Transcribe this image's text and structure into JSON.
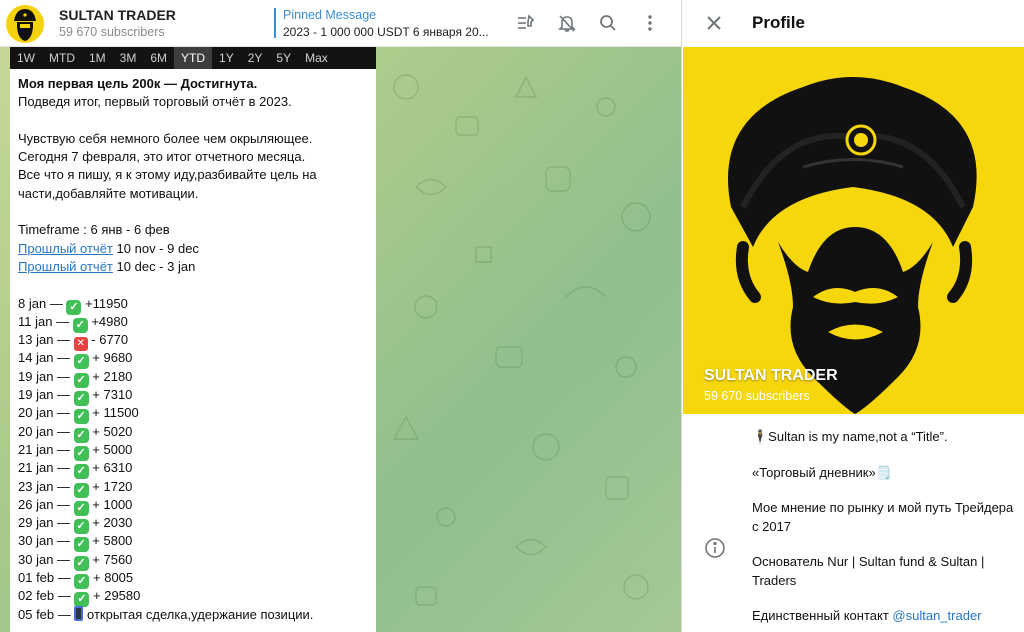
{
  "header": {
    "channel_name": "SULTAN TRADER",
    "subscribers": "59 670 subscribers",
    "pinned_label": "Pinned Message",
    "pinned_text": "2023 - 1 000 000 USDT 6 января 20..."
  },
  "timeframes": [
    "1W",
    "MTD",
    "1M",
    "3M",
    "6M",
    "YTD",
    "1Y",
    "2Y",
    "5Y",
    "Max"
  ],
  "timeframe_selected": "YTD",
  "message": {
    "title": "Моя первая цель 200к — Достигнута.",
    "line2": "Подведя итог, первый торговый отчёт в 2023.",
    "para1": "Чувствую себя немного более чем окрыляющее.",
    "para2": "Сегодня 7 февраля, это итог отчетного месяца.",
    "para3": "Все что я пишу, я к этому иду,разбивайте цель на",
    "para4": "части,добавляйте мотивации.",
    "timeframe": "Timeframe : 6 янв - 6 фев",
    "link1": "Прошлый отчёт",
    "link1_range": "10 nov - 9 dec",
    "link2": "Прошлый отчёт",
    "link2_range": "10 dec - 3 jan"
  },
  "trades": [
    {
      "date": "8 jan",
      "status": "win",
      "value": "+11950"
    },
    {
      "date": "11 jan",
      "status": "win",
      "value": "+4980"
    },
    {
      "date": "13 jan",
      "status": "loss",
      "value": "- 6770"
    },
    {
      "date": "14 jan",
      "status": "win",
      "value": "+ 9680"
    },
    {
      "date": "19 jan",
      "status": "win",
      "value": "+ 2180"
    },
    {
      "date": "19 jan",
      "status": "win",
      "value": "+ 7310"
    },
    {
      "date": "20 jan",
      "status": "win",
      "value": "+ 11500"
    },
    {
      "date": "20 jan",
      "status": "win",
      "value": "+ 5020"
    },
    {
      "date": "21 jan",
      "status": "win",
      "value": "+ 5000"
    },
    {
      "date": "21 jan",
      "status": "win",
      "value": "+ 6310"
    },
    {
      "date": "23 jan",
      "status": "win",
      "value": "+ 1720"
    },
    {
      "date": "26 jan",
      "status": "win",
      "value": "+ 1000"
    },
    {
      "date": "29 jan",
      "status": "win",
      "value": "+ 2030"
    },
    {
      "date": "30 jan",
      "status": "win",
      "value": "+ 5800"
    },
    {
      "date": "30 jan",
      "status": "win",
      "value": "+ 7560"
    },
    {
      "date": "01 feb",
      "status": "win",
      "value": "+ 8005"
    },
    {
      "date": "02 feb",
      "status": "win",
      "value": "+ 29580"
    },
    {
      "date": "05 feb",
      "status": "open",
      "value": "открытая сделка,удержание позиции."
    }
  ],
  "profile": {
    "panel_title": "Profile",
    "name": "SULTAN TRADER",
    "subscribers": "59 670 subscribers",
    "about1": "🕴️Sultan is my name,not a “Title”.",
    "about2": "«Торговый дневник»🗒️",
    "about3": "Мое мнение по рынку и мой путь Трейдера с 2017",
    "about4": "Основатель Nur | Sultan fund & Sultan | Traders",
    "contact_label": "Единственный контакт",
    "contact_handle": "@sultan_trader"
  },
  "colors": {
    "accent": "#3a8fd6",
    "brand_yellow": "#f6d70b",
    "win": "#40c057",
    "loss": "#e84343"
  },
  "icons": [
    "unpin-icon",
    "mute-icon",
    "search-icon",
    "more-icon",
    "close-icon",
    "info-icon"
  ]
}
